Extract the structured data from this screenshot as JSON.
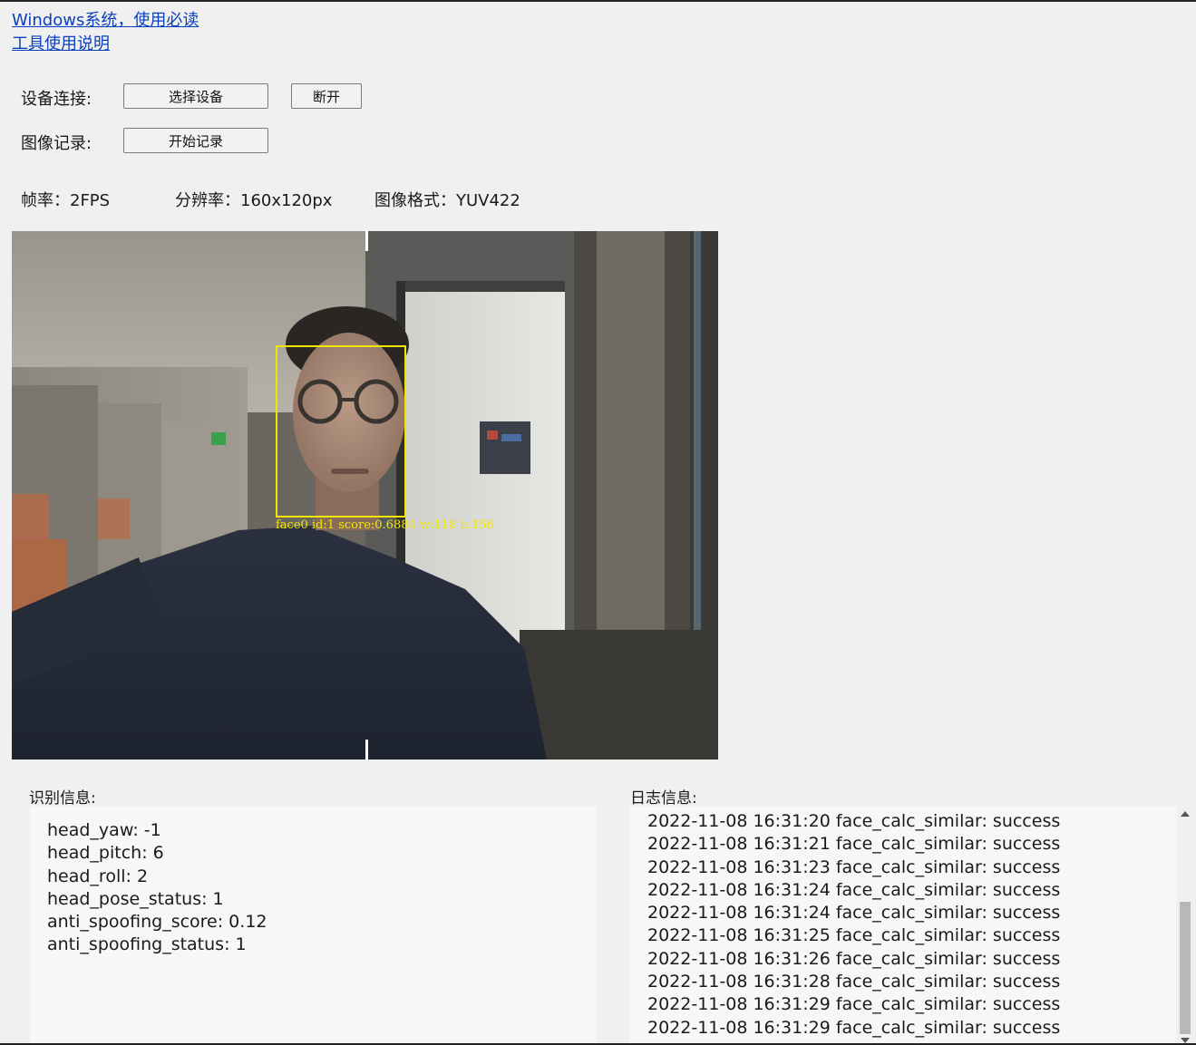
{
  "links": {
    "windows_guide": "Windows系统，使用必读",
    "tool_guide": "工具使用说明"
  },
  "device": {
    "label": "设备连接:",
    "select_button": "选择设备",
    "disconnect_button": "断开"
  },
  "recording": {
    "label": "图像记录:",
    "start_button": "开始记录"
  },
  "stats": {
    "fps": "帧率：2FPS",
    "resolution": "分辨率：160x120px",
    "format": "图像格式：YUV422"
  },
  "camera": {
    "detection_label": "face0 id:1 score:0.6884 w:118 h:156",
    "box_color": "#f2e600"
  },
  "recognition": {
    "title": "识别信息:",
    "lines": [
      "head_yaw: -1",
      "head_pitch: 6",
      "head_roll: 2",
      "head_pose_status: 1",
      "anti_spoofing_score: 0.12",
      "anti_spoofing_status: 1"
    ]
  },
  "log": {
    "title": "日志信息:",
    "lines": [
      "2022-11-08 16:31:20 face_calc_similar: success",
      "2022-11-08 16:31:21 face_calc_similar: success",
      "2022-11-08 16:31:23 face_calc_similar: success",
      "2022-11-08 16:31:24 face_calc_similar: success",
      "2022-11-08 16:31:24 face_calc_similar: success",
      "2022-11-08 16:31:25 face_calc_similar: success",
      "2022-11-08 16:31:26 face_calc_similar: success",
      "2022-11-08 16:31:28 face_calc_similar: success",
      "2022-11-08 16:31:29 face_calc_similar: success",
      "2022-11-08 16:31:29 face_calc_similar: success"
    ]
  }
}
